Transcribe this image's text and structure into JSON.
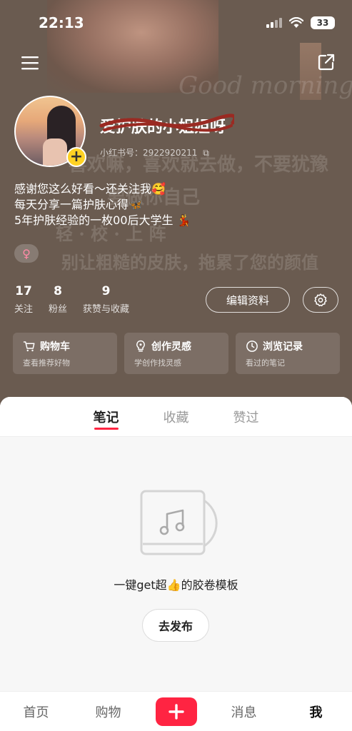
{
  "status": {
    "time": "22:13",
    "battery": "33"
  },
  "profile": {
    "nickname": "爱护肤的小姐姐呀",
    "id_label": "小红书号：",
    "id_value": "2922920211",
    "bio_lines": [
      "感谢您这么好看～还关注我🥰",
      "每天分享一篇护肤心得🦋",
      "5年护肤经验的一枚00后大学生 💃"
    ],
    "gender_symbol": "♀"
  },
  "header_deco": {
    "script": "Good morning",
    "line1": "喜欢嘛，喜欢就去做，不要犹豫",
    "line2": "要做你自己",
    "line3": "轻 · 校 · 上 阵",
    "line4": "别让粗糙的皮肤，拖累了您的颜值"
  },
  "stats": [
    {
      "num": "17",
      "label": "关注"
    },
    {
      "num": "8",
      "label": "粉丝"
    },
    {
      "num": "9",
      "label": "获赞与收藏"
    }
  ],
  "buttons": {
    "edit": "编辑资料"
  },
  "quick_cards": [
    {
      "title": "购物车",
      "sub": "查看推荐好物",
      "icon": "cart-icon"
    },
    {
      "title": "创作灵感",
      "sub": "学创作找灵感",
      "icon": "lightbulb-icon"
    },
    {
      "title": "浏览记录",
      "sub": "看过的笔记",
      "icon": "clock-icon"
    }
  ],
  "tabs": [
    "笔记",
    "收藏",
    "赞过"
  ],
  "empty": {
    "text": "一键get超👍的胶卷模板",
    "button": "去发布"
  },
  "bottom_nav": {
    "home": "首页",
    "shop": "购物",
    "messages": "消息",
    "me": "我"
  },
  "colors": {
    "accent": "#ff2442",
    "header_bg": "#6a5b50"
  }
}
